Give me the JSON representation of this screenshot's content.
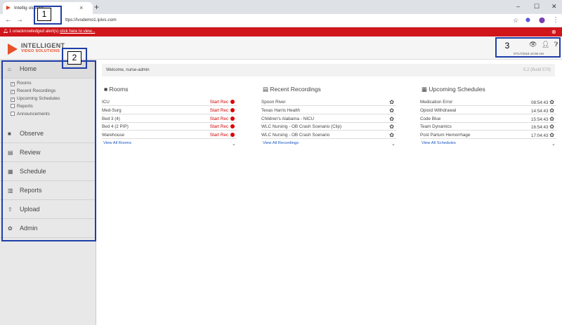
{
  "browser": {
    "tab_title": "Intellig       olutions",
    "url": "ttps://ivsdemo1.ipivs.com",
    "new_tab": "+",
    "tab_close": "×",
    "back": "←",
    "forward": "→",
    "window_controls": [
      "–",
      "☐",
      "✕"
    ],
    "toolbar_icons": [
      "☆",
      "⬢",
      "⬤",
      "⋮"
    ]
  },
  "alert": {
    "prefix": "1 unacknowledged alert(s) ",
    "link": "click here to view..."
  },
  "header": {
    "logo_line1": "INTELLIGENT",
    "logo_line2": "VIDEO SOLUTIONS",
    "icons": [
      "eye-icon",
      "user-icon",
      "help-icon"
    ],
    "datetime": "07/17/2018 10:05 AM"
  },
  "sidebar": {
    "home": "Home",
    "home_items": [
      {
        "label": "Rooms",
        "checked": true
      },
      {
        "label": "Recent Recordings",
        "checked": true
      },
      {
        "label": "Upcoming Schedules",
        "checked": true
      },
      {
        "label": "Reports",
        "checked": false
      },
      {
        "label": "Announcements",
        "checked": false
      }
    ],
    "nav": [
      "Observe",
      "Review",
      "Schedule",
      "Reports",
      "Upload",
      "Admin"
    ]
  },
  "main": {
    "welcome": "Welcome, nurse-admin",
    "build": "5.2 (Build 570)",
    "rooms": {
      "title": "Rooms",
      "items": [
        {
          "name": "ICU",
          "action": "Start Rec"
        },
        {
          "name": "Med-Surg",
          "action": "Start Rec"
        },
        {
          "name": "Bed 3 (4)",
          "action": "Start Rec"
        },
        {
          "name": "Bed 4 (2 PIP)",
          "action": "Start Rec"
        },
        {
          "name": "Warehouse",
          "action": "Start Rec"
        }
      ],
      "view_all": "View All Rooms"
    },
    "recordings": {
      "title": "Recent Recordings",
      "items": [
        "Spoon River",
        "Texas Harris Health",
        "Children's Alabama - NICU",
        "WLC Nursing - OB Crash Scenario (Clip)",
        "WLC Nursing - OB Crash Scenario"
      ],
      "view_all": "View All Recordings"
    },
    "schedules": {
      "title": "Upcoming Schedules",
      "items": [
        {
          "name": "Medication Error",
          "time": "08:54:43"
        },
        {
          "name": "Opioid Withdrawal",
          "time": "14:54:43"
        },
        {
          "name": "Code Blue",
          "time": "15:54:43"
        },
        {
          "name": "Team Dynamics",
          "time": "16:54:43"
        },
        {
          "name": "Post Partum Hemorrhage",
          "time": "17:04:43"
        }
      ],
      "view_all": "View All Schedules"
    }
  },
  "callouts": [
    "1",
    "2",
    "3"
  ],
  "colors": {
    "alert_red": "#d0151b",
    "brand_orange": "#e8502a",
    "callout_blue": "#1f3ea8",
    "link_blue": "#1a56c4"
  }
}
